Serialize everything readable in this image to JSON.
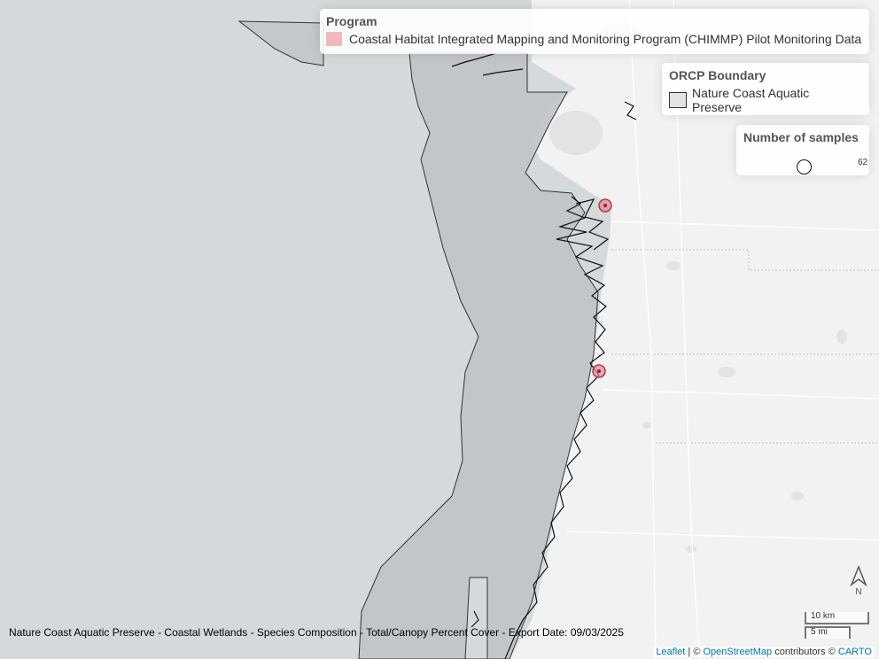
{
  "map": {
    "basemap": "CartoDB Positron",
    "colors": {
      "water": "#d4dadc",
      "land": "#f2f2f2",
      "preserve_fill": "#c1c5c8",
      "preserve_stroke": "#333333",
      "sample_point": "#e48a92"
    },
    "samples": [
      {
        "label": "sample-point-north",
        "count": 62
      },
      {
        "label": "sample-point-south",
        "count": 62
      }
    ]
  },
  "legend_program": {
    "title": "Program",
    "item": "Coastal Habitat Integrated Mapping and Monitoring Program (CHIMMP) Pilot Monitoring Data",
    "color": "#f1b9bd"
  },
  "legend_orcp": {
    "title": "ORCP Boundary",
    "item": "Nature Coast Aquatic Preserve"
  },
  "legend_samples": {
    "title": "Number of samples",
    "value": "62"
  },
  "caption": "Nature Coast Aquatic Preserve - Coastal Wetlands - Species Composition - Total/Canopy Percent Cover - Export Date: 09/03/2025",
  "scale": {
    "km_label": "10 km",
    "mi_label": "5 mi"
  },
  "north_label": "N",
  "attribution": {
    "leaflet": "Leaflet",
    "separator": " | © ",
    "osm": "OpenStreetMap",
    "contributors": " contributors © ",
    "carto": "CARTO"
  }
}
